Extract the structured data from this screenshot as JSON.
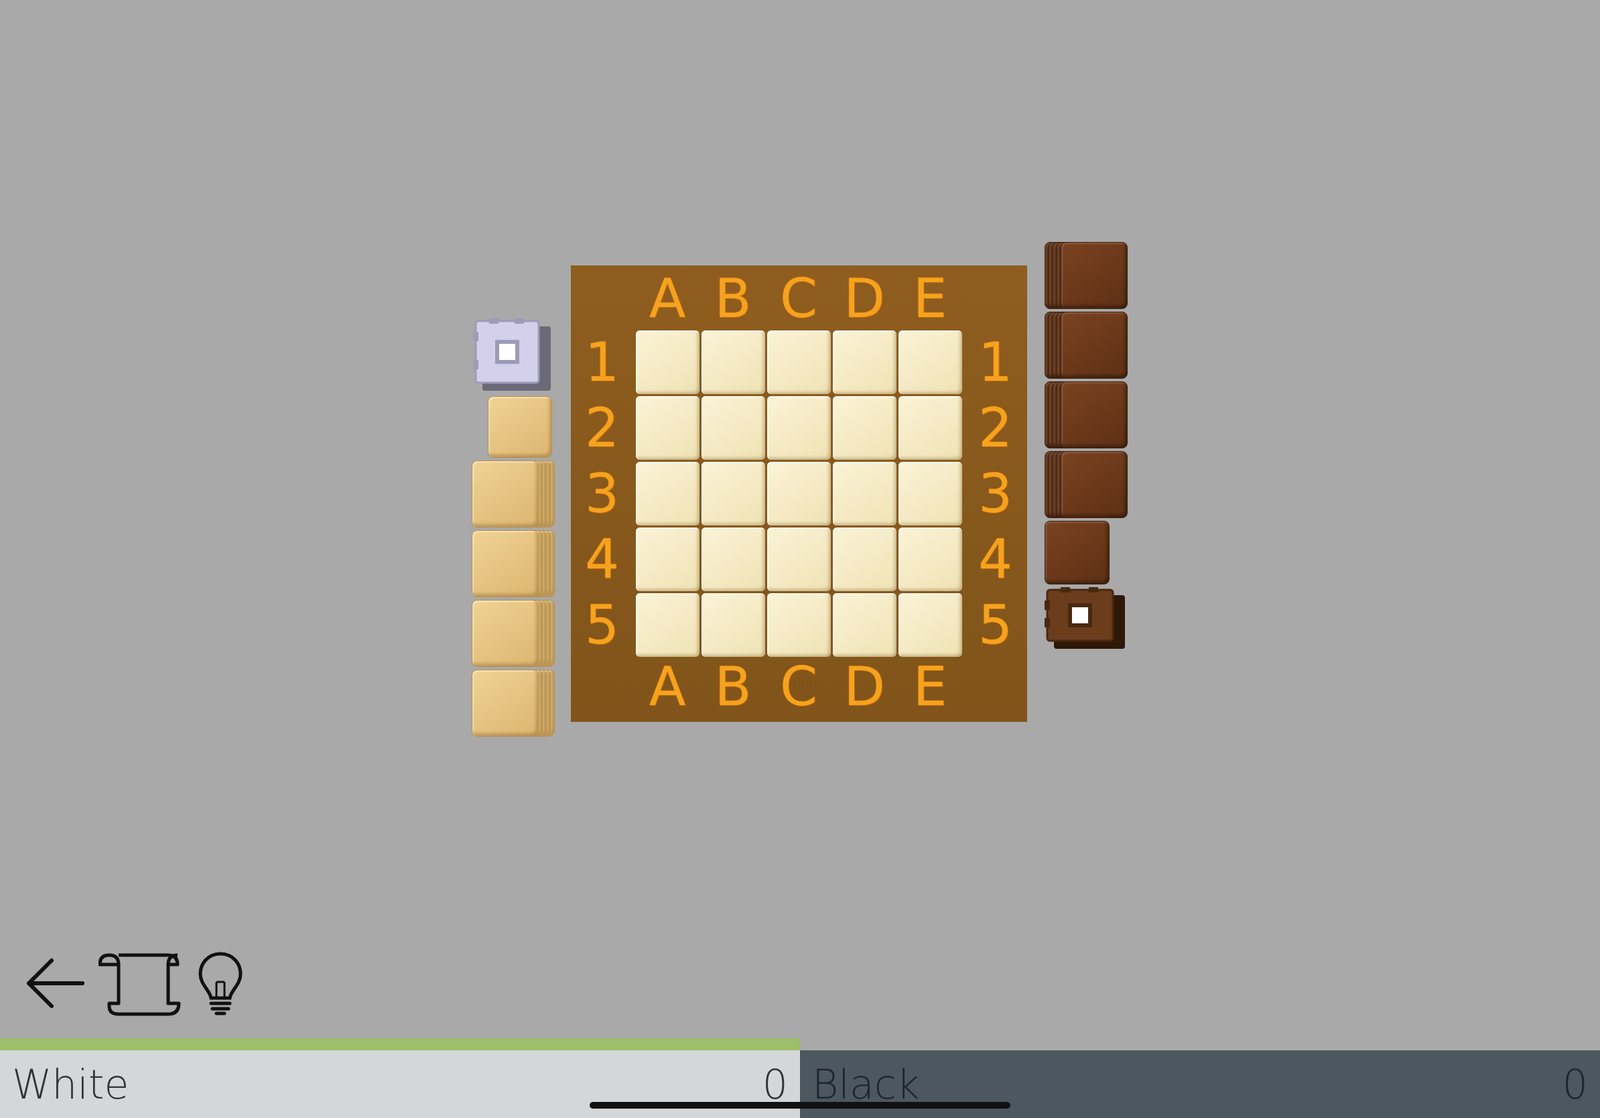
{
  "board": {
    "columns": [
      "A",
      "B",
      "C",
      "D",
      "E"
    ],
    "rows": [
      "1",
      "2",
      "3",
      "4",
      "5"
    ]
  },
  "reserves": [
    {
      "side": "white",
      "pieces": [
        {
          "kind": "capstone"
        },
        {
          "kind": "flat",
          "count": 1
        },
        {
          "kind": "flat",
          "count": 5
        },
        {
          "kind": "flat",
          "count": 5
        },
        {
          "kind": "flat",
          "count": 5
        },
        {
          "kind": "flat",
          "count": 5
        }
      ]
    },
    {
      "side": "black",
      "pieces": [
        {
          "kind": "flat",
          "count": 5
        },
        {
          "kind": "flat",
          "count": 5
        },
        {
          "kind": "flat",
          "count": 5
        },
        {
          "kind": "flat",
          "count": 5
        },
        {
          "kind": "flat",
          "count": 1
        },
        {
          "kind": "capstone"
        }
      ]
    }
  ],
  "players": [
    {
      "name": "White",
      "score": "0",
      "selected": true
    },
    {
      "name": "Black",
      "score": "0",
      "selected": false
    }
  ]
}
